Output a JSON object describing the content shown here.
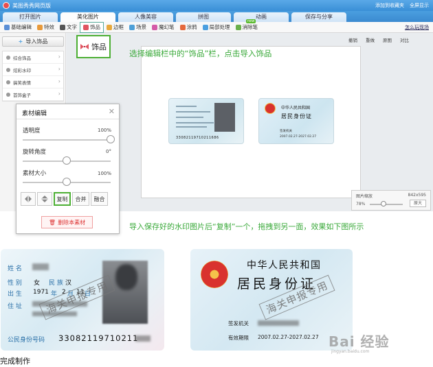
{
  "app": {
    "title": "美图秀秀网页版",
    "top_links": [
      "添加到收藏夹",
      "全屏显示"
    ]
  },
  "tabs": [
    {
      "label": "打开图片",
      "active": false
    },
    {
      "label": "美化图片",
      "active": true
    },
    {
      "label": "人像美容",
      "active": false
    },
    {
      "label": "拼图",
      "active": false
    },
    {
      "label": "动画",
      "active": false
    },
    {
      "label": "保存与分享",
      "active": false
    }
  ],
  "toolbar": {
    "items": [
      {
        "label": "基础编辑",
        "color": "#5b8fd6"
      },
      {
        "label": "特效",
        "color": "#e89a3c"
      },
      {
        "label": "文字",
        "color": "#555555"
      },
      {
        "label": "饰品",
        "color": "#e05561"
      },
      {
        "label": "边框",
        "color": "#e8a93c"
      },
      {
        "label": "场景",
        "color": "#4ea0d8"
      },
      {
        "label": "魔幻笔",
        "color": "#d45aa8"
      },
      {
        "label": "涂鸦",
        "color": "#e5683c"
      },
      {
        "label": "局部处理",
        "color": "#4b9fe0"
      },
      {
        "label": "消除笔",
        "color": "#6ab04c"
      }
    ],
    "new_badge": "new",
    "right_link": "怎么玩现场"
  },
  "sidebar": {
    "import_button": "导入饰品",
    "categories": [
      "综合饰品",
      "炫彩水印",
      "搞笑表情",
      "首饰盒子"
    ]
  },
  "workspace": {
    "undo": "撤销",
    "redo": "重做",
    "original": "原图",
    "compare": "对比",
    "zoom_label": "图片缩放",
    "image_size": "842x595",
    "zoom_percent": "78%",
    "zoom_button": "原大"
  },
  "mini_cards": {
    "front_number": "33082119710211686",
    "back_title": "中华人民共和国",
    "back_subtitle": "居民身份证",
    "back_authority": "签发机关",
    "back_validity": "2007.02.27-2027.02.27"
  },
  "deco_callout": "饰品",
  "panel": {
    "title": "素材编辑",
    "opacity_label": "透明度",
    "opacity_value": "100%",
    "opacity_level": 1.0,
    "rotate_label": "旋转角度",
    "rotate_value": "0°",
    "rotate_level": 0.5,
    "size_label": "素材大小",
    "size_value": "100%",
    "size_level": 0.5,
    "copy_button": "复制",
    "merge_button": "合并",
    "blend_button": "融合",
    "delete_button": "删除本素材"
  },
  "annotations": {
    "step1": "选择编辑栏中的“饰品”栏，点击导入饰品",
    "step2": "导入保存好的水印图片后“复制”一个，拖拽到另一面，效果如下图所示"
  },
  "id_front": {
    "name_label": "姓 名",
    "gender_label": "性 别",
    "gender_value": "女",
    "ethnicity_label": "民 族",
    "ethnicity_value": "汉",
    "birth_label": "出 生",
    "birth_year": "1971",
    "birth_year_unit": "年",
    "birth_month": "2",
    "birth_month_unit": "月",
    "birth_day": "11",
    "birth_day_unit": "日",
    "address_label": "住 址",
    "number_label": "公民身份号码",
    "number_value": "33082119710211",
    "watermark": "海关申报专用"
  },
  "id_back": {
    "country": "中华人民共和国",
    "card_name": "居民身份证",
    "authority_label": "签发机关",
    "validity_label": "有效期限",
    "validity_value": "2007.02.27-2027.02.27",
    "watermark": "海关申报专用"
  },
  "baidu_logo": {
    "brand": "Bai 经验",
    "url": "jingyan.baidu.com"
  },
  "footer": "完成制作"
}
